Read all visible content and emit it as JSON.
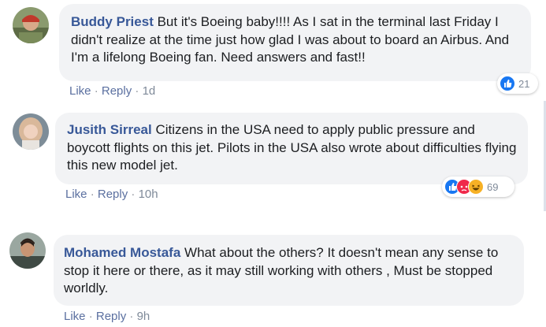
{
  "comments": [
    {
      "author": "Buddy Priest",
      "text": " But it's Boeing baby!!!! As I sat in the terminal last Friday I didn't realize at the time just how glad I was about to board an Airbus. And I'm a lifelong Boeing fan. Need answers and fast!!",
      "like": "Like",
      "reply": "Reply",
      "time": "1d",
      "reaction_count": "21",
      "reactions": [
        "like-icon"
      ]
    },
    {
      "author": "Jusith Sirreal",
      "text": " Citizens in the USA need to apply public pressure and boycott flights on this jet. Pilots in the USA also wrote about difficulties flying this new model jet.",
      "like": "Like",
      "reply": "Reply",
      "time": "10h",
      "reaction_count": "69",
      "reactions": [
        "like-icon",
        "angry-icon",
        "haha-icon"
      ]
    },
    {
      "author": "Mohamed Mostafa",
      "text": " What about the others? It doesn't mean any sense to stop it here or there, as it may still working with others , Must be stopped worldly.",
      "like": "Like",
      "reply": "Reply",
      "time": "9h"
    }
  ],
  "separator": "·",
  "colors": {
    "author": "#385898",
    "bubble": "#f2f3f5",
    "like_blue": "#1877f2",
    "angry_red": "#f0284a",
    "haha_yellow": "#f7b125"
  }
}
